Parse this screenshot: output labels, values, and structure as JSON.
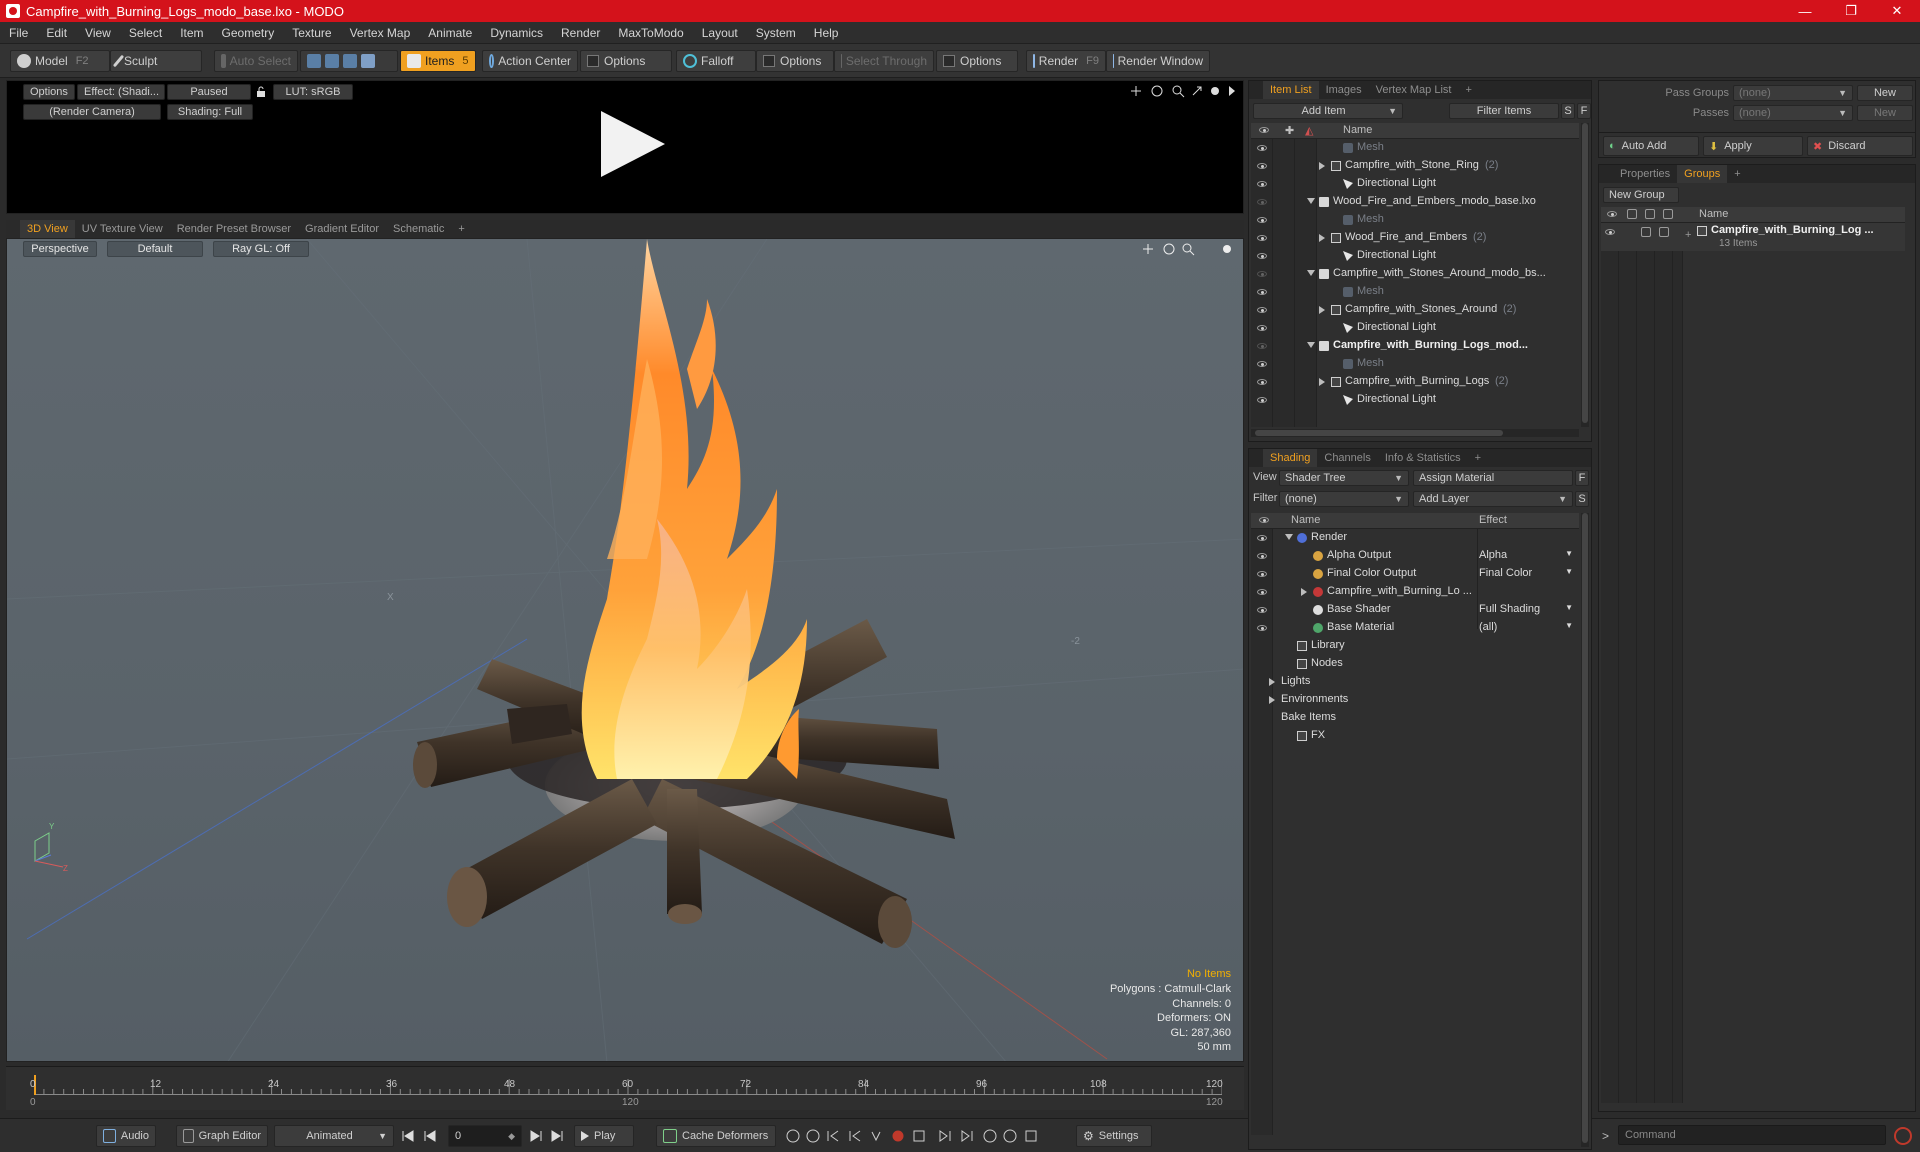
{
  "window": {
    "title": "Campfire_with_Burning_Logs_modo_base.lxo - MODO",
    "minimize": "—",
    "maximize": "❐",
    "close": "✕"
  },
  "menu": [
    "File",
    "Edit",
    "View",
    "Select",
    "Item",
    "Geometry",
    "Texture",
    "Vertex Map",
    "Animate",
    "Dynamics",
    "Render",
    "MaxToModo",
    "Layout",
    "System",
    "Help"
  ],
  "toolbar": {
    "model": "Model",
    "model_key": "F2",
    "sculpt": "Sculpt",
    "auto_select": "Auto Select",
    "items": "Items",
    "items_key": "5",
    "action_center": "Action Center",
    "options1": "Options",
    "falloff": "Falloff",
    "options2": "Options",
    "select_through": "Select Through",
    "options3": "Options",
    "render": "Render",
    "render_key": "F9",
    "render_window": "Render Window"
  },
  "preview": {
    "options": "Options",
    "effect": "Effect: (Shadi...",
    "paused": "Paused",
    "lut": "LUT: sRGB",
    "camera": "(Render Camera)",
    "shading": "Shading: Full"
  },
  "viewport_tabs": [
    "3D View",
    "UV Texture View",
    "Render Preset Browser",
    "Gradient Editor",
    "Schematic",
    "+"
  ],
  "viewport": {
    "perspective": "Perspective",
    "default": "Default",
    "raygl": "Ray GL: Off",
    "stats": {
      "items": "No Items",
      "polygons": "Polygons : Catmull-Clark",
      "channels": "Channels: 0",
      "deformers": "Deformers: ON",
      "gl": "GL: 287,360",
      "size": "50 mm"
    },
    "axis_x": "X",
    "axis_y": "Y",
    "axis_z": "Z",
    "grid_marker": "-2"
  },
  "timeline": {
    "ticks": [
      "0",
      "12",
      "24",
      "36",
      "48",
      "60",
      "72",
      "84",
      "96",
      "108",
      "120"
    ],
    "start": "0",
    "mid": "120",
    "end": "120"
  },
  "bottombar": {
    "audio": "Audio",
    "graph_editor": "Graph Editor",
    "animated": "Animated",
    "frame": "0",
    "play": "Play",
    "cache": "Cache Deformers",
    "settings": "Settings"
  },
  "item_list": {
    "tabs": [
      "Item List",
      "Images",
      "Vertex Map List",
      "+"
    ],
    "add_item": "Add Item",
    "filter_items": "Filter Items",
    "s": "S",
    "f": "F",
    "col_name": "Name",
    "rows": [
      {
        "label": "Mesh",
        "kind": "mesh",
        "indent": 3
      },
      {
        "label": "Campfire_with_Stone_Ring",
        "count": "(2)",
        "kind": "group",
        "indent": 2
      },
      {
        "label": "Directional Light",
        "kind": "light",
        "indent": 3
      },
      {
        "label": "Wood_Fire_and_Embers_modo_base.lxo",
        "kind": "scene",
        "indent": 1
      },
      {
        "label": "Mesh",
        "kind": "mesh",
        "indent": 3
      },
      {
        "label": "Wood_Fire_and_Embers",
        "count": "(2)",
        "kind": "group",
        "indent": 2
      },
      {
        "label": "Directional Light",
        "kind": "light",
        "indent": 3
      },
      {
        "label": "Campfire_with_Stones_Around_modo_bs...",
        "kind": "scene",
        "indent": 1
      },
      {
        "label": "Mesh",
        "kind": "mesh",
        "indent": 3
      },
      {
        "label": "Campfire_with_Stones_Around",
        "count": "(2)",
        "kind": "group",
        "indent": 2
      },
      {
        "label": "Directional Light",
        "kind": "light",
        "indent": 3
      },
      {
        "label": "Campfire_with_Burning_Logs_mod...",
        "kind": "scene",
        "indent": 1,
        "bold": true
      },
      {
        "label": "Mesh",
        "kind": "mesh",
        "indent": 3
      },
      {
        "label": "Campfire_with_Burning_Logs",
        "count": "(2)",
        "kind": "group",
        "indent": 2
      },
      {
        "label": "Directional Light",
        "kind": "light",
        "indent": 3
      }
    ]
  },
  "shading": {
    "tabs": [
      "Shading",
      "Channels",
      "Info & Statistics",
      "+"
    ],
    "view_label": "View",
    "view_value": "Shader Tree",
    "assign_material": "Assign Material",
    "filter_label": "Filter",
    "filter_value": "(none)",
    "add_layer": "Add Layer",
    "f": "F",
    "s": "S",
    "col_name": "Name",
    "col_effect": "Effect",
    "rows": [
      {
        "label": "Render",
        "effect": "",
        "icon": "#4f6fd8",
        "indent": 1,
        "eye": true
      },
      {
        "label": "Alpha Output",
        "effect": "Alpha",
        "icon": "#d9a441",
        "indent": 2,
        "eye": true
      },
      {
        "label": "Final Color Output",
        "effect": "Final Color",
        "icon": "#d9a441",
        "indent": 2,
        "eye": true
      },
      {
        "label": "Campfire_with_Burning_Lo ...",
        "effect": "",
        "icon": "#c43838",
        "indent": 2,
        "eye": true
      },
      {
        "label": "Base Shader",
        "effect": "Full Shading",
        "icon": "#dedede",
        "indent": 2,
        "eye": true
      },
      {
        "label": "Base Material",
        "effect": "(all)",
        "icon": "#4fa66a",
        "indent": 2,
        "eye": true
      },
      {
        "label": "Library",
        "effect": "",
        "icon": "",
        "indent": 1,
        "eye": false
      },
      {
        "label": "Nodes",
        "effect": "",
        "icon": "",
        "indent": 1,
        "eye": false
      },
      {
        "label": "Lights",
        "effect": "",
        "icon": "",
        "indent": 0,
        "eye": false
      },
      {
        "label": "Environments",
        "effect": "",
        "icon": "",
        "indent": 0,
        "eye": false
      },
      {
        "label": "Bake Items",
        "effect": "",
        "icon": "",
        "indent": 0,
        "eye": false
      },
      {
        "label": "FX",
        "effect": "",
        "icon": "",
        "indent": 1,
        "eye": false
      }
    ]
  },
  "groups": {
    "pass_groups": "Pass Groups",
    "pass_groups_value": "(none)",
    "new": "New",
    "passes": "Passes",
    "passes_value": "(none)",
    "new2": "New",
    "auto_add": "Auto Add",
    "apply": "Apply",
    "discard": "Discard",
    "tabs": [
      "Properties",
      "Groups",
      "+"
    ],
    "new_group": "New Group",
    "col_name": "Name",
    "item_name": "Campfire_with_Burning_Log ...",
    "item_count": "13 Items"
  },
  "command": {
    "prompt": ">",
    "placeholder": "Command"
  }
}
